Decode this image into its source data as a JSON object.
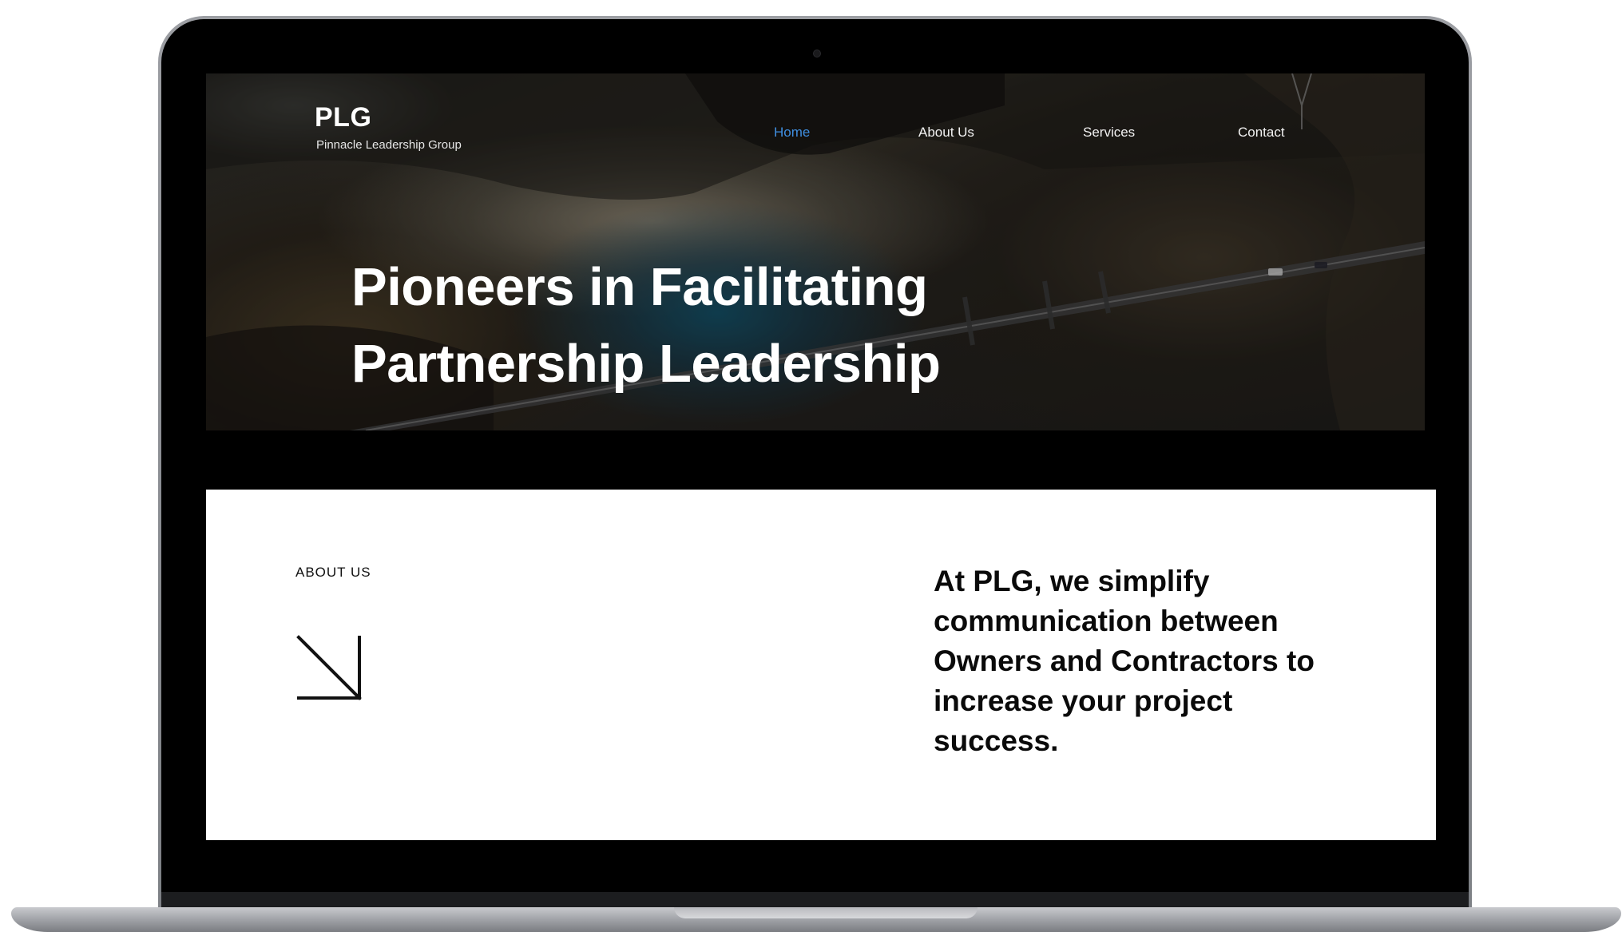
{
  "site": {
    "logo": "PLG",
    "tagline": "Pinnacle Leadership Group"
  },
  "nav": {
    "items": [
      {
        "label": "Home",
        "active": true
      },
      {
        "label": "About Us",
        "active": false
      },
      {
        "label": "Services",
        "active": false
      },
      {
        "label": "Contact",
        "active": false
      }
    ],
    "active_color": "#3f8fe0"
  },
  "hero": {
    "title_line1": "Pioneers in Facilitating",
    "title_line2": "Partnership Leadership"
  },
  "about": {
    "label": "ABOUT US",
    "icon": "arrow-down-right-icon",
    "text": "At PLG, we simplify communication between Owners and Contractors to increase your project success."
  },
  "device": {
    "frame": "laptop"
  }
}
